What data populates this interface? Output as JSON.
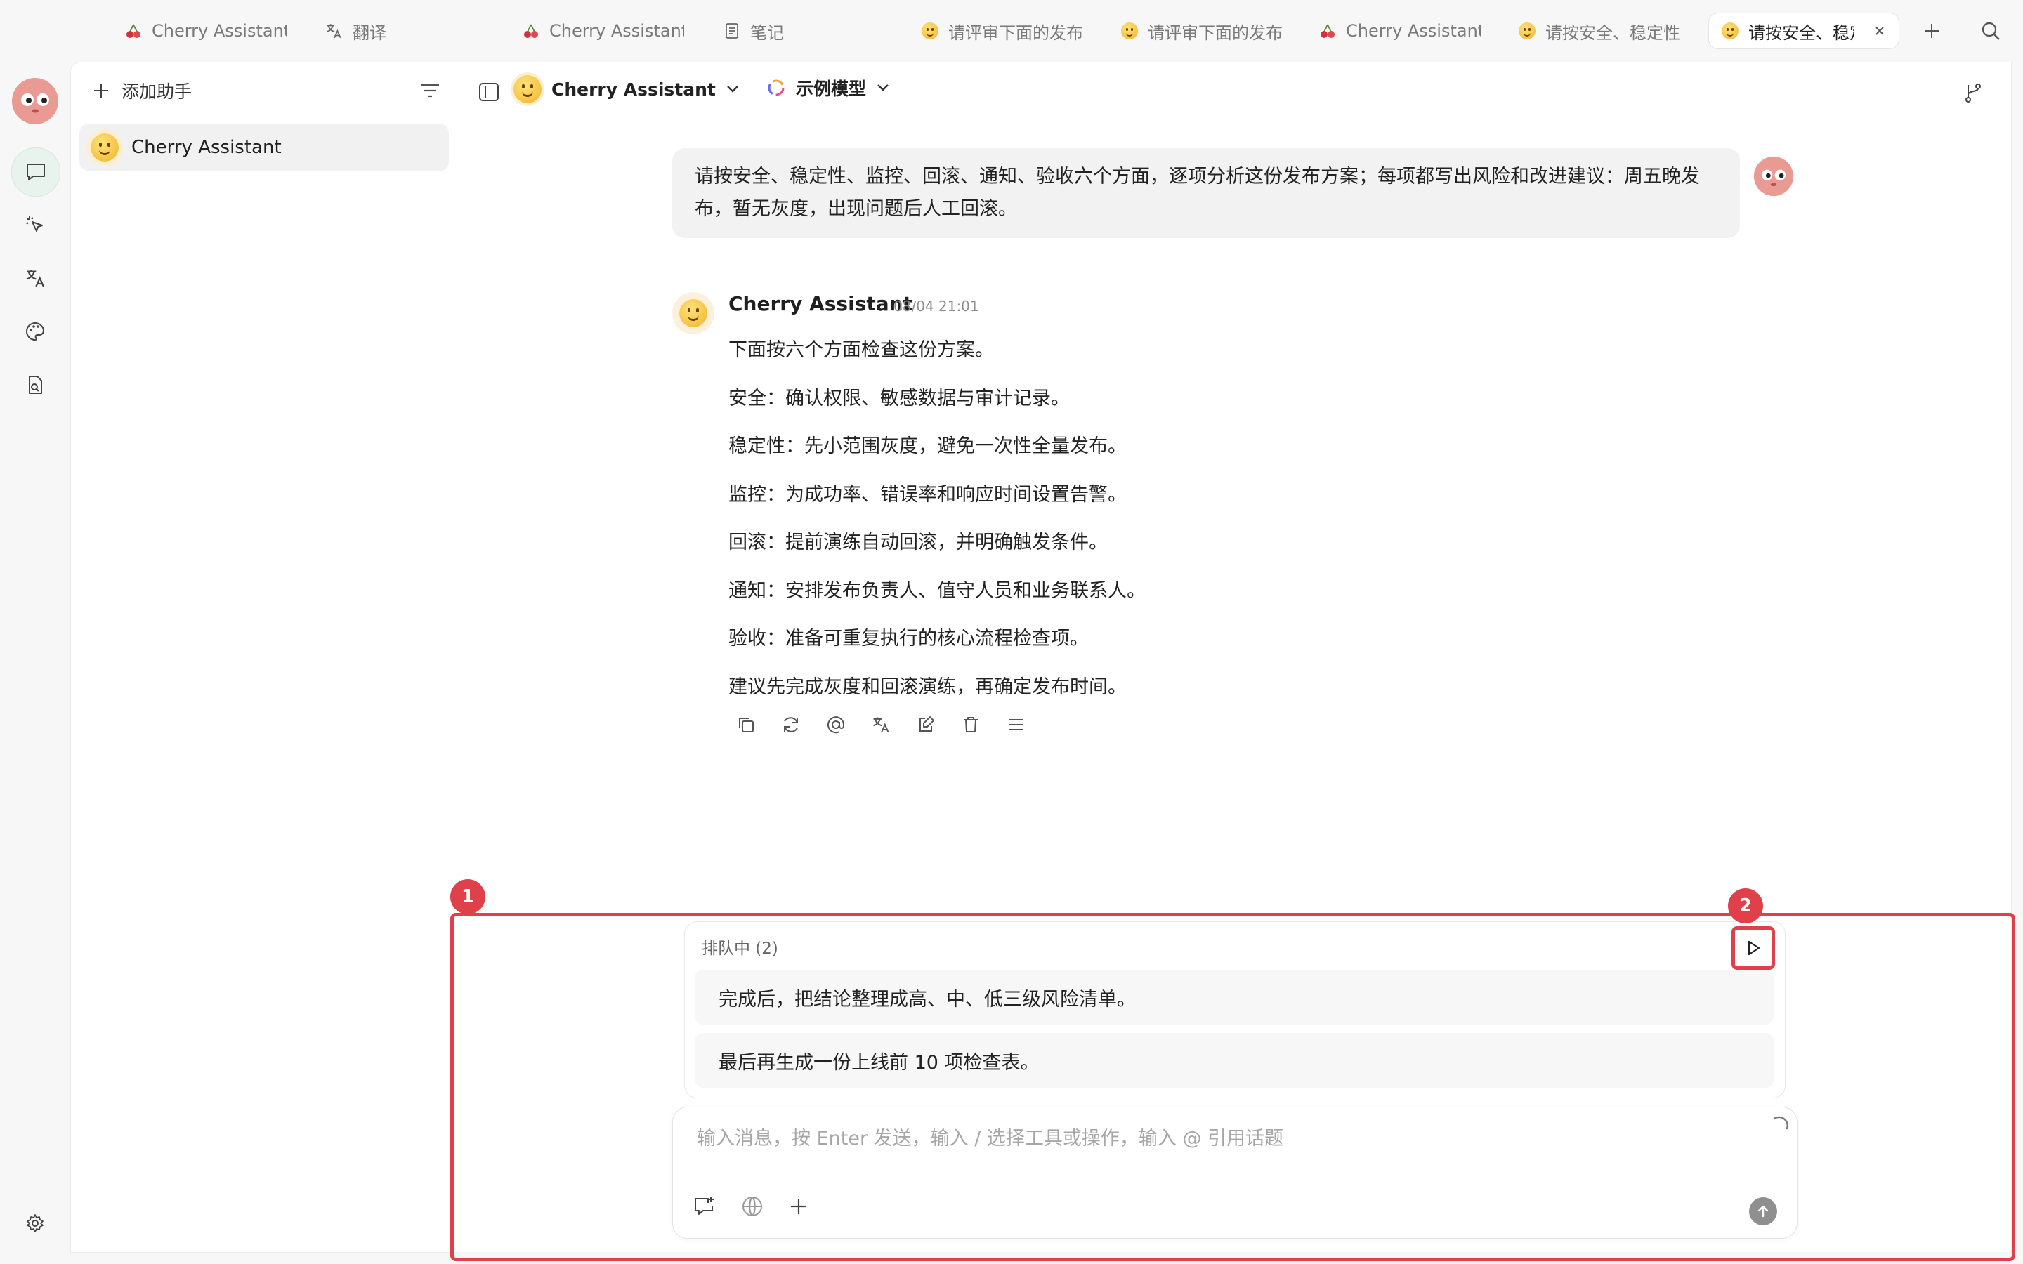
{
  "tabs": [
    {
      "label": "Cherry Assistant",
      "icon": "cherry-icon"
    },
    {
      "label": "翻译",
      "icon": "translate-icon"
    },
    {
      "label": "Cherry Assistant",
      "icon": "cherry-icon"
    },
    {
      "label": "笔记",
      "icon": "notes-icon"
    },
    {
      "label": "请评审下面的发布",
      "icon": "emoji-icon"
    },
    {
      "label": "请评审下面的发布",
      "icon": "emoji-icon"
    },
    {
      "label": "Cherry Assistant",
      "icon": "cherry-icon"
    },
    {
      "label": "请按安全、稳定性",
      "icon": "emoji-icon"
    },
    {
      "label": "请按安全、稳定",
      "icon": "emoji-icon",
      "active": true
    }
  ],
  "sidebar": {
    "add_assistant": "添加助手",
    "assistants": [
      {
        "name": "Cherry Assistant"
      }
    ]
  },
  "header": {
    "assistant_name": "Cherry Assistant",
    "model_name": "示例模型"
  },
  "conversation": {
    "user_message": "请按安全、稳定性、监控、回滚、通知、验收六个方面，逐项分析这份发布方案；每项都写出风险和改进建议：周五晚发布，暂无灰度，出现问题后人工回滚。",
    "assistant": {
      "name": "Cherry Assistant",
      "time": "08/04 21:01",
      "lines": [
        "下面按六个方面检查这份方案。",
        "安全：确认权限、敏感数据与审计记录。",
        "稳定性：先小范围灰度，避免一次性全量发布。",
        "监控：为成功率、错误率和响应时间设置告警。",
        "回滚：提前演练自动回滚，并明确触发条件。",
        "通知：安排发布负责人、值守人员和业务联系人。",
        "验收：准备可重复执行的核心流程检查项。",
        "建议先完成灰度和回滚演练，再确定发布时间。"
      ]
    }
  },
  "queue": {
    "title": "排队中 (2)",
    "items": [
      "完成后，把结论整理成高、中、低三级风险清单。",
      "最后再生成一份上线前 10 项检查表。"
    ]
  },
  "input": {
    "placeholder": "输入消息，按 Enter 发送，输入 / 选择工具或操作，输入 @ 引用话题"
  },
  "annotations": {
    "marker_1": "1",
    "marker_2": "2"
  },
  "colors": {
    "highlight": "#e0404a",
    "active_rail": "#e8f3ee"
  }
}
